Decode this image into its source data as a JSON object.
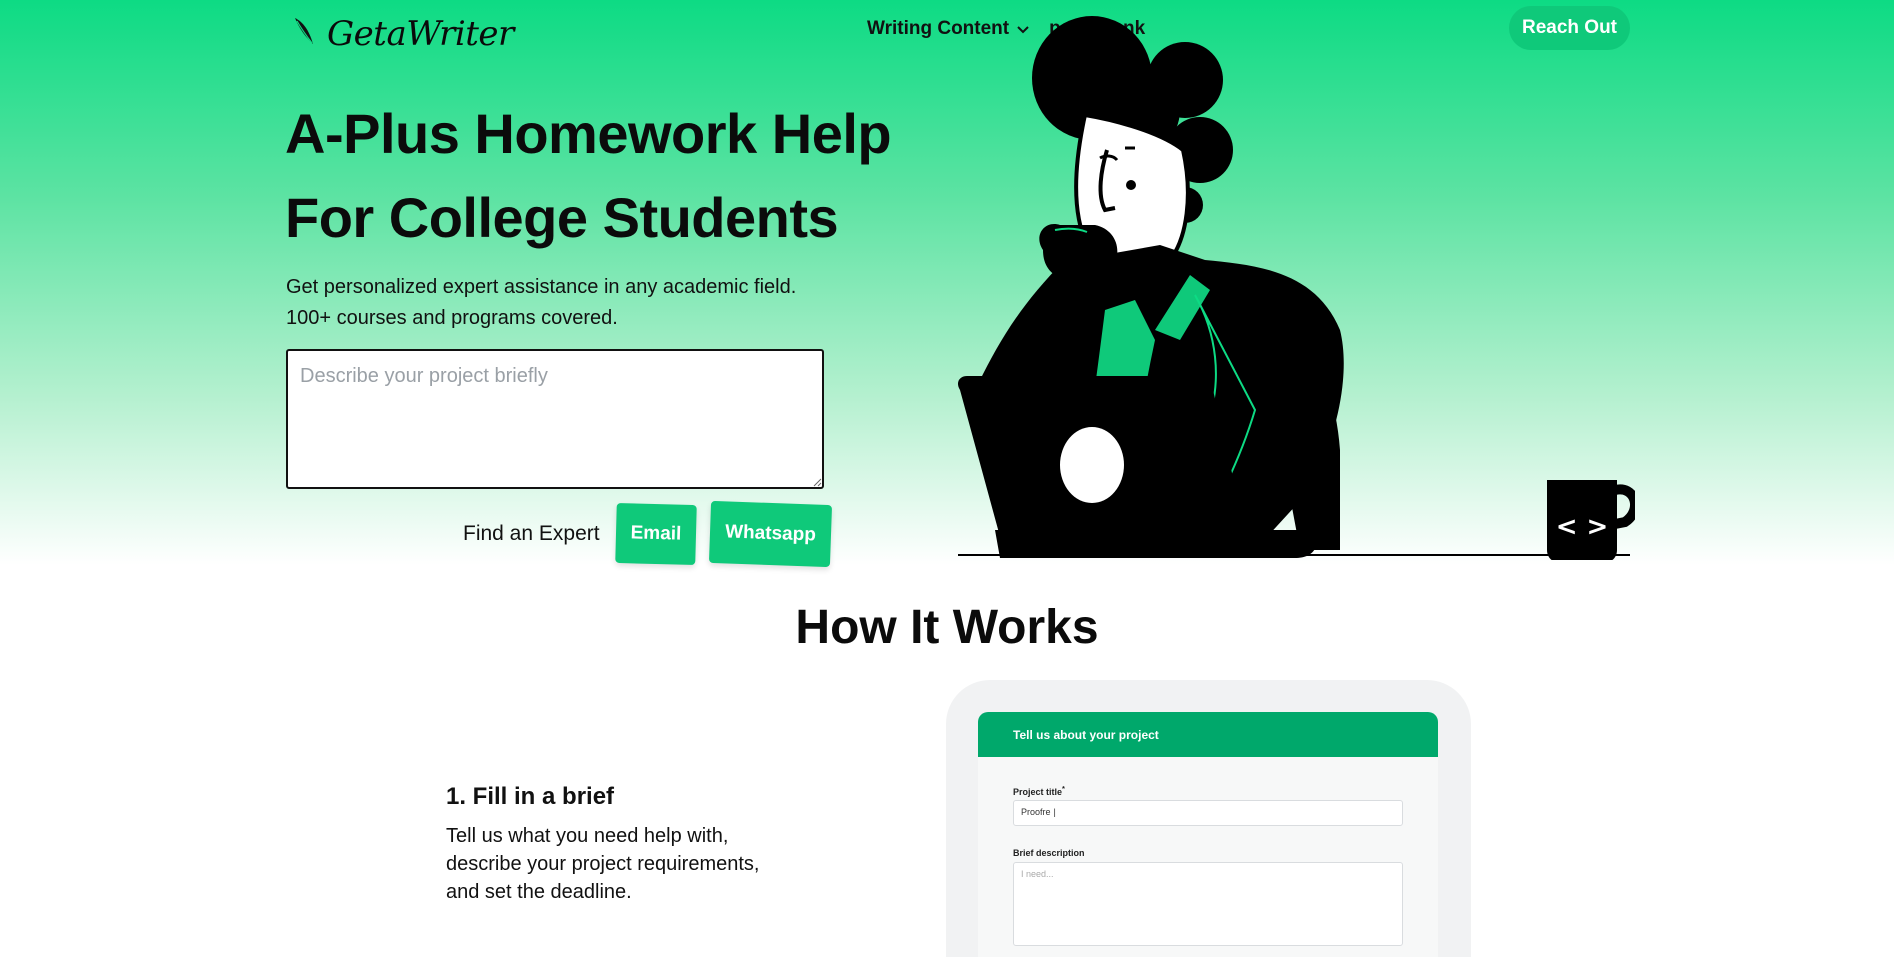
{
  "brand": {
    "name": "GetaWriter"
  },
  "nav": {
    "items": [
      {
        "label": "Writing Content",
        "has_dropdown": true
      },
      {
        "label": "paperbank",
        "has_dropdown": false
      }
    ],
    "cta": "Reach Out"
  },
  "hero": {
    "title_line1": "A-Plus Homework Help",
    "title_line2": "For College Students",
    "subtitle_line1": "Get personalized expert assistance in any academic field.",
    "subtitle_line2": "100+ courses and programs covered.",
    "brief_placeholder": "Describe your project briefly",
    "find_label": "Find an Expert",
    "email_button": "Email",
    "whatsapp_button": "Whatsapp",
    "mug_text": "< >"
  },
  "how": {
    "title": "How It Works",
    "step1_title": "1. Fill in a brief",
    "step1_text": "Tell us what you need help with, describe your project requirements, and set the deadline."
  },
  "mockup": {
    "header": "Tell us about your project",
    "project_title_label": "Project title",
    "project_title_required": "*",
    "project_title_value": "Proofre",
    "brief_label": "Brief description",
    "brief_placeholder": "I need..."
  },
  "colors": {
    "accent": "#0fc97a",
    "accent_dark": "#00a86b",
    "text": "#111111"
  },
  "icons": [
    "quill-logo-icon",
    "chevron-down-icon"
  ]
}
